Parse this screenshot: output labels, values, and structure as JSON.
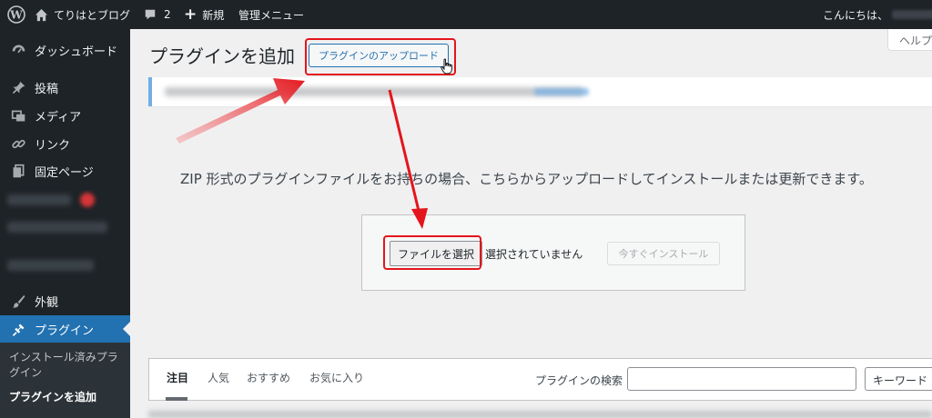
{
  "adminbar": {
    "site_name": "てりはとブログ",
    "comments_count": "2",
    "new_label": "新規",
    "admin_menu_label": "管理メニュー",
    "greeting": "こんにちは、"
  },
  "sidebar": {
    "items": [
      {
        "label": "ダッシュボード",
        "icon": "gauge-icon"
      },
      {
        "label": "投稿",
        "icon": "pushpin-icon"
      },
      {
        "label": "メディア",
        "icon": "media-icon"
      },
      {
        "label": "リンク",
        "icon": "link-icon"
      },
      {
        "label": "固定ページ",
        "icon": "page-icon"
      },
      {
        "label": "外観",
        "icon": "brush-icon"
      }
    ],
    "active_item": {
      "label": "プラグイン",
      "icon": "plugin-icon"
    },
    "submenu": {
      "installed_line1": "インストール済みプラ",
      "installed_line2": "グイン",
      "add_new": "プラグインを追加"
    }
  },
  "help_tab": "ヘルプ",
  "page": {
    "title": "プラグインを追加",
    "upload_button": "プラグインのアップロード",
    "upload_help": "ZIP 形式のプラグインファイルをお持ちの場合、こちらからアップロードしてインストールまたは更新できます。",
    "choose_file": "ファイルを選択",
    "no_file": "選択されていません",
    "install_now": "今すぐインストール"
  },
  "filter": {
    "tabs": [
      "注目",
      "人気",
      "おすすめ",
      "お気に入り"
    ],
    "search_label": "プラグインの検索",
    "search_type": "キーワード"
  },
  "colors": {
    "admin_bar": "#1d2327",
    "accent": "#2271b1",
    "highlight": "#e4151c"
  }
}
